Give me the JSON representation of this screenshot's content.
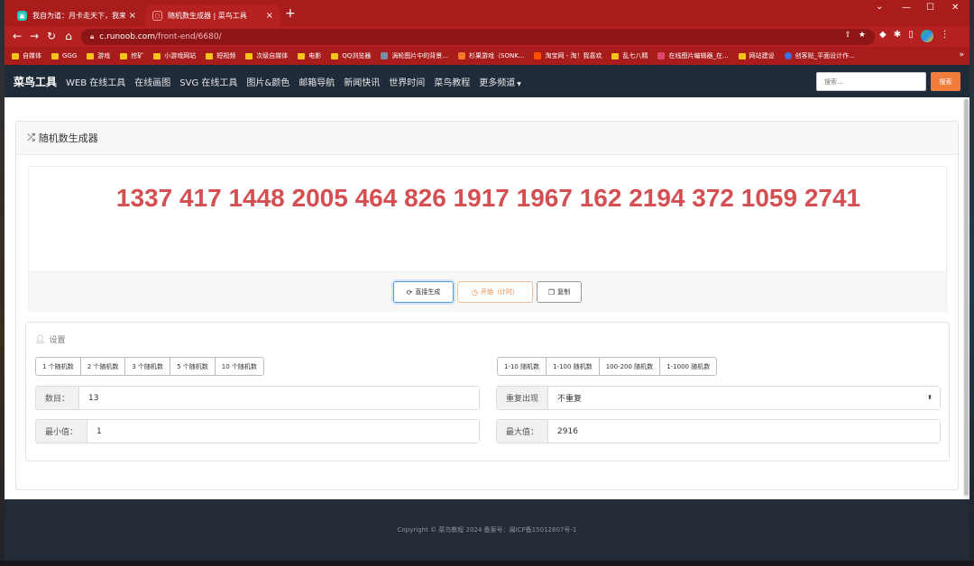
{
  "browser": {
    "tabs": [
      {
        "title": "我自为道：月卡走天下，我来证",
        "favicon": "bilibili-icon"
      },
      {
        "title": "随机数生成器 | 菜鸟工具",
        "favicon": "runoob-icon"
      }
    ],
    "url_host": "c.runoob.com",
    "url_path": "/front-end/6680/",
    "bookmarks": [
      "自媒体",
      "GGG",
      "游戏",
      "挖矿",
      "小游戏网站",
      "短视频",
      "次级自媒体",
      "电影",
      "QQ浏览器",
      "涡轮图片中的背景...",
      "杉果游戏（SONK...",
      "淘宝网 - 淘！我喜欢",
      "乱七八精",
      "在线图片编辑器_在...",
      "网站建设",
      "创客贴_平面设计作..."
    ]
  },
  "site_nav": {
    "brand": "菜鸟工具",
    "links": [
      "WEB 在线工具",
      "在线画图",
      "SVG 在线工具",
      "图片&颜色",
      "邮箱导航",
      "新闻快讯",
      "世界时间",
      "菜鸟教程",
      "更多频道"
    ],
    "search_placeholder": "搜索...",
    "search_button": "搜索"
  },
  "panel": {
    "title": "随机数生成器",
    "result": "1337 417 1448 2005 464 826 1917 1967 162 2194 372 1059 2741",
    "buttons": {
      "generate": "直接生成",
      "start": "开始（计时）",
      "copy": "复制"
    }
  },
  "settings": {
    "title": "设置",
    "count_presets": [
      "1 个随机数",
      "2 个随机数",
      "3 个随机数",
      "5 个随机数",
      "10 个随机数"
    ],
    "range_presets": [
      "1-10 随机数",
      "1-100 随机数",
      "100-200 随机数",
      "1-1000 随机数"
    ],
    "count_label": "数目：",
    "count_value": "13",
    "min_label": "最小值：",
    "min_value": "1",
    "repeat_label": "重复出现",
    "repeat_value": "不重复",
    "max_label": "最大值：",
    "max_value": "2916"
  },
  "footer": {
    "text": "Copyright © 菜鸟教程 2024 备案号：闽ICP备15012807号-1"
  },
  "colors": {
    "tab_bar": "#a81c1c",
    "site_nav_bg": "#1f2b38",
    "result_red": "#d34f52",
    "search_button": "#f27c3c",
    "footer_bg": "#232c36"
  }
}
